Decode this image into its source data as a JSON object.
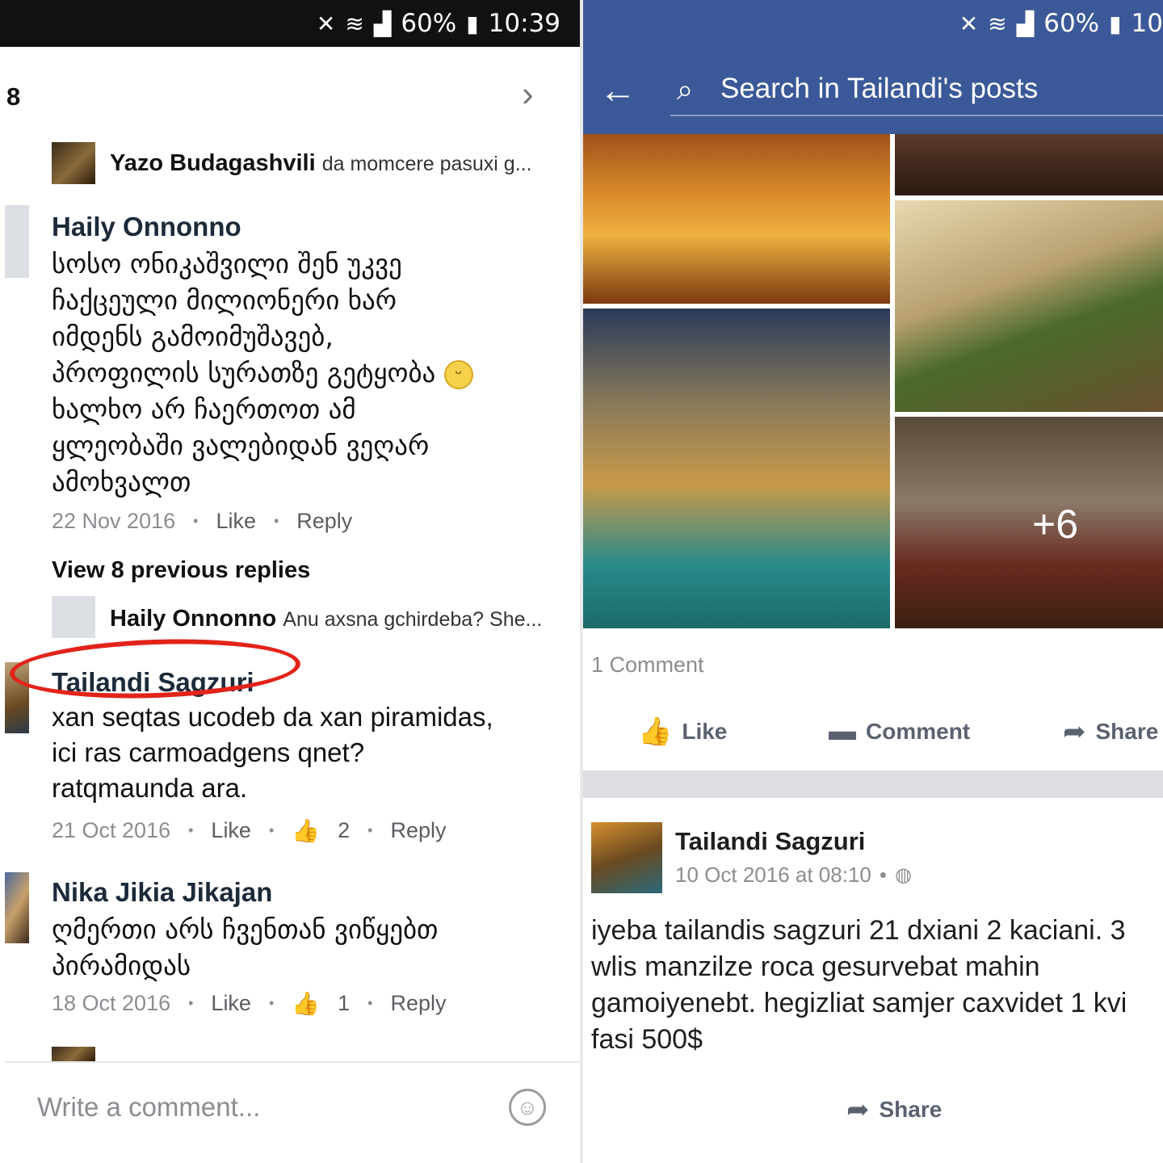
{
  "left": {
    "status": {
      "signal": "60%",
      "time": "10:39"
    },
    "header": {
      "count": "8"
    },
    "reply_top": {
      "name": "Yazo Budagashvili",
      "snippet": "da momcere pasuxi g..."
    },
    "comment1": {
      "name": "Haily Onnonno",
      "lines": [
        "სოსო ონიკაშვილი შენ უკვე",
        "ჩაქცეული მილიონერი ხარ",
        "იმდენს გამოიმუშავებ,",
        "პროფილის სურათზე გეტყობა",
        "ხალხო არ ჩაერთოთ ამ",
        "ყლეობაში ვალებიდან ვეღარ",
        "ამოხვალთ"
      ],
      "date": "22 Nov 2016",
      "like": "Like",
      "reply": "Reply"
    },
    "view_previous": "View 8 previous replies",
    "reply_mid": {
      "name": "Haily Onnonno",
      "snippet": "Anu axsna gchirdeba? She..."
    },
    "comment2": {
      "name": "Tailandi Sagzuri",
      "lines": [
        "xan seqtas ucodeb da xan piramidas,",
        "ici ras carmoadgens qnet?",
        "ratqmaunda ara."
      ],
      "date": "21 Oct 2016",
      "like": "Like",
      "likes": "2",
      "reply": "Reply"
    },
    "comment3": {
      "name": "Nika Jikia Jikajan",
      "lines": [
        "ღმერთი არს ჩვენთან ვიწყებთ",
        "პირამიდას"
      ],
      "date": "18 Oct 2016",
      "like": "Like",
      "likes": "1",
      "reply": "Reply"
    },
    "footer": {
      "placeholder": "Write a comment..."
    }
  },
  "right": {
    "status": {
      "signal": "60%",
      "time": "10"
    },
    "search": {
      "placeholder": "Search in Tailandi's posts"
    },
    "photos_more": "+6",
    "comments_count": "1 Comment",
    "actions": {
      "like": "Like",
      "comment": "Comment",
      "share": "Share"
    },
    "post": {
      "author": "Tailandi Sagzuri",
      "date": "10 Oct 2016 at 08:10",
      "lines": [
        "iyeba tailandis sagzuri 21 dxiani 2 kaciani. 3",
        "wlis manzilze roca gesurvebat mahin",
        "gamoiyenebt. hegizliat samjer caxvidet 1 kvi",
        "fasi 500$"
      ],
      "share": "Share"
    }
  },
  "colors": {
    "facebook_blue": "#3b5998",
    "annotation_red": "#e2231a"
  }
}
